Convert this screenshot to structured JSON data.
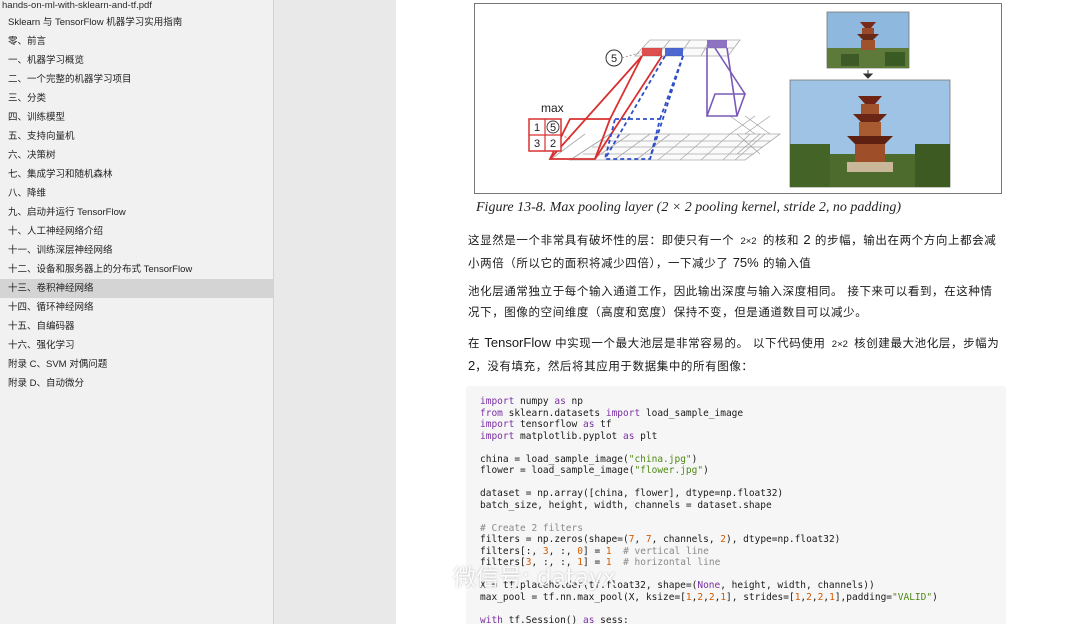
{
  "sidebar": {
    "pdf_title": "hands-on-ml-with-sklearn-and-tf.pdf",
    "items": [
      {
        "label": "Sklearn 与 TensorFlow 机器学习实用指南",
        "active": false
      },
      {
        "label": "零、前言",
        "active": false
      },
      {
        "label": "一、机器学习概览",
        "active": false
      },
      {
        "label": "二、一个完整的机器学习项目",
        "active": false
      },
      {
        "label": "三、分类",
        "active": false
      },
      {
        "label": "四、训练模型",
        "active": false
      },
      {
        "label": "五、支持向量机",
        "active": false
      },
      {
        "label": "六、决策树",
        "active": false
      },
      {
        "label": "七、集成学习和随机森林",
        "active": false
      },
      {
        "label": "八、降维",
        "active": false
      },
      {
        "label": "九、启动并运行 TensorFlow",
        "active": false
      },
      {
        "label": "十、人工神经网络介绍",
        "active": false
      },
      {
        "label": "十一、训练深层神经网络",
        "active": false
      },
      {
        "label": "十二、设备和服务器上的分布式 TensorFlow",
        "active": false
      },
      {
        "label": "十三、卷积神经网络",
        "active": true
      },
      {
        "label": "十四、循环神经网络",
        "active": false
      },
      {
        "label": "十五、自编码器",
        "active": false
      },
      {
        "label": "十六、强化学习",
        "active": false
      },
      {
        "label": "附录 C、SVM 对偶问题",
        "active": false
      },
      {
        "label": "附录 D、自动微分",
        "active": false
      }
    ]
  },
  "figure": {
    "caption": "Figure 13-8. Max pooling layer (2 × 2 pooling kernel, stride 2, no padding)",
    "max_label": "max",
    "circle_value": "5",
    "grid_values": [
      "1",
      "5",
      "3",
      "2"
    ]
  },
  "paragraphs": {
    "p1": {
      "part1": "这显然是一个非常具有破坏性的层：即使只有一个 ",
      "code1": "2×2",
      "part2": " 的核和 ",
      "num1": "2",
      "part3": " 的步幅，输出在两个方向上都会减小两倍（所以它的面积将减少四倍），一下减少了 ",
      "num2": "75%",
      "part4": " 的输入值"
    },
    "p2": "池化层通常独立于每个输入通道工作，因此输出深度与输入深度相同。 接下来可以看到，在这种情况下，图像的空间维度（高度和宽度）保持不变，但是通道数目可以减少。",
    "p3": {
      "part1": "在 ",
      "tf": "TensorFlow",
      "part2": " 中实现一个最大池层是非常容易的。 以下代码使用 ",
      "code1": "2×2",
      "part3": " 核创建最大池化层，步幅为",
      "num1": "2",
      "part4": "，没有填充，然后将其应用于数据集中的所有图像："
    }
  },
  "code_lines": [
    [
      [
        "kw",
        "import"
      ],
      [
        "t",
        " numpy "
      ],
      [
        "kw",
        "as"
      ],
      [
        "t",
        " np"
      ]
    ],
    [
      [
        "kw",
        "from"
      ],
      [
        "t",
        " sklearn.datasets "
      ],
      [
        "kw",
        "import"
      ],
      [
        "t",
        " load_sample_image"
      ]
    ],
    [
      [
        "kw",
        "import"
      ],
      [
        "t",
        " tensorflow "
      ],
      [
        "kw",
        "as"
      ],
      [
        "t",
        " tf"
      ]
    ],
    [
      [
        "kw",
        "import"
      ],
      [
        "t",
        " matplotlib.pyplot "
      ],
      [
        "kw",
        "as"
      ],
      [
        "t",
        " plt"
      ]
    ],
    [],
    [
      [
        "t",
        "china = load_sample_image("
      ],
      [
        "str",
        "\"china.jpg\""
      ],
      [
        "t",
        ")"
      ]
    ],
    [
      [
        "t",
        "flower = load_sample_image("
      ],
      [
        "str",
        "\"flower.jpg\""
      ],
      [
        "t",
        ")"
      ]
    ],
    [],
    [
      [
        "t",
        "dataset = np.array([china, flower], dtype=np.float32)"
      ]
    ],
    [
      [
        "t",
        "batch_size, height, width, channels = dataset.shape"
      ]
    ],
    [],
    [
      [
        "cm",
        "# Create 2 filters"
      ]
    ],
    [
      [
        "t",
        "filters = np.zeros(shape=("
      ],
      [
        "num",
        "7"
      ],
      [
        "t",
        ", "
      ],
      [
        "num",
        "7"
      ],
      [
        "t",
        ", channels, "
      ],
      [
        "num",
        "2"
      ],
      [
        "t",
        "), dtype=np.float32)"
      ]
    ],
    [
      [
        "t",
        "filters[:, "
      ],
      [
        "num",
        "3"
      ],
      [
        "t",
        ", :, "
      ],
      [
        "num",
        "0"
      ],
      [
        "t",
        "] = "
      ],
      [
        "num",
        "1"
      ],
      [
        "t",
        "  "
      ],
      [
        "cm",
        "# vertical line"
      ]
    ],
    [
      [
        "t",
        "filters["
      ],
      [
        "num",
        "3"
      ],
      [
        "t",
        ", :, :, "
      ],
      [
        "num",
        "1"
      ],
      [
        "t",
        "] = "
      ],
      [
        "num",
        "1"
      ],
      [
        "t",
        "  "
      ],
      [
        "cm",
        "# horizontal line"
      ]
    ],
    [],
    [
      [
        "t",
        "X = tf.placeholder(tf.float32, shape=("
      ],
      [
        "kw",
        "None"
      ],
      [
        "t",
        ", height, width, channels))"
      ]
    ],
    [
      [
        "t",
        "max_pool = tf.nn.max_pool(X, ksize=["
      ],
      [
        "num",
        "1"
      ],
      [
        "t",
        ","
      ],
      [
        "num",
        "2"
      ],
      [
        "t",
        ","
      ],
      [
        "num",
        "2"
      ],
      [
        "t",
        ","
      ],
      [
        "num",
        "1"
      ],
      [
        "t",
        "], strides=["
      ],
      [
        "num",
        "1"
      ],
      [
        "t",
        ","
      ],
      [
        "num",
        "2"
      ],
      [
        "t",
        ","
      ],
      [
        "num",
        "2"
      ],
      [
        "t",
        ","
      ],
      [
        "num",
        "1"
      ],
      [
        "t",
        "],padding="
      ],
      [
        "str",
        "\"VALID\""
      ],
      [
        "t",
        ")"
      ]
    ],
    [],
    [
      [
        "kw",
        "with"
      ],
      [
        "t",
        " tf.Session() "
      ],
      [
        "kw",
        "as"
      ],
      [
        "t",
        " sess:"
      ]
    ]
  ],
  "watermark": {
    "text": "微信号: datayx",
    "icon": "wechat-icon"
  },
  "colors": {
    "red": "#d83030",
    "blue": "#2e4ec8",
    "purple": "#7a5ab8",
    "sidebar_active": "#d4d4d4"
  }
}
